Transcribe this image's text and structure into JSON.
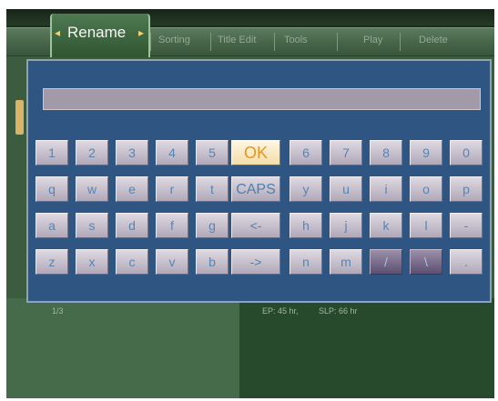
{
  "tabs": {
    "active": "Rename",
    "items": [
      "Sorting",
      "Title Edit",
      "Tools",
      "Play",
      "Delete"
    ]
  },
  "keyboard": {
    "input_value": "",
    "rows": [
      [
        "1",
        "2",
        "3",
        "4",
        "5",
        "OK",
        "6",
        "7",
        "8",
        "9",
        "0"
      ],
      [
        "q",
        "w",
        "e",
        "r",
        "t",
        "CAPS",
        "y",
        "u",
        "i",
        "o",
        "p"
      ],
      [
        "a",
        "s",
        "d",
        "f",
        "g",
        "<-",
        "h",
        "j",
        "k",
        "l",
        "-"
      ],
      [
        "z",
        "x",
        "c",
        "v",
        "b",
        "->",
        "n",
        "m",
        "/",
        "\\",
        "."
      ]
    ],
    "selected_key": "OK"
  },
  "status": {
    "page": "1/3",
    "ep": "EP: 45 hr,",
    "slp": "SLP: 66 hr"
  },
  "colors": {
    "dialog_background": "#2f5583",
    "selected_key_text": "#e8951e",
    "key_text": "#5a84b0"
  }
}
